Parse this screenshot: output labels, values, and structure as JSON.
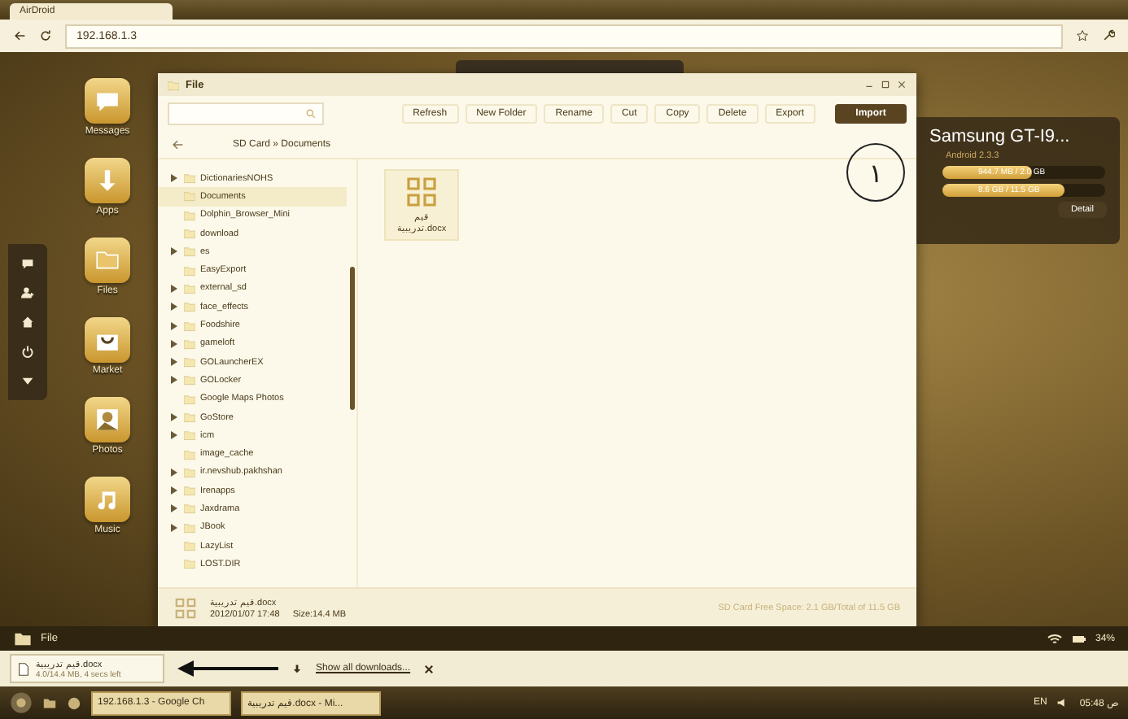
{
  "browser": {
    "tab": "AirDroid",
    "url": "192.168.1.3"
  },
  "dock_apps": [
    {
      "label": "Messages",
      "kind": "messages"
    },
    {
      "label": "Apps",
      "kind": "apps"
    },
    {
      "label": "Files",
      "kind": "files"
    },
    {
      "label": "Market",
      "kind": "market"
    },
    {
      "label": "Photos",
      "kind": "photos"
    },
    {
      "label": "Music",
      "kind": "music"
    }
  ],
  "side_tools": [
    {
      "kind": "chat"
    },
    {
      "kind": "user"
    },
    {
      "kind": "home"
    },
    {
      "kind": "power"
    },
    {
      "kind": "down"
    }
  ],
  "file_window": {
    "title": "File",
    "toolbar": [
      {
        "label": "Refresh",
        "kind": "plain"
      },
      {
        "label": "New Folder",
        "kind": "plain"
      },
      {
        "label": "Rename",
        "kind": "plain"
      },
      {
        "label": "Cut",
        "kind": "plain"
      },
      {
        "label": "Copy",
        "kind": "plain"
      },
      {
        "label": "Delete",
        "kind": "plain"
      },
      {
        "label": "Export",
        "kind": "plain"
      },
      {
        "label": "Import",
        "kind": "primary"
      }
    ],
    "path": "SD Card » Documents",
    "tree": [
      {
        "name": "DictionariesNOHS",
        "expandable": true,
        "selected": false
      },
      {
        "name": "Documents",
        "expandable": false,
        "selected": true
      },
      {
        "name": "Dolphin_Browser_Mini",
        "expandable": false,
        "selected": false
      },
      {
        "name": "download",
        "expandable": false,
        "selected": false
      },
      {
        "name": "es",
        "expandable": true,
        "selected": false
      },
      {
        "name": "EasyExport",
        "expandable": false,
        "selected": false
      },
      {
        "name": "external_sd",
        "expandable": true,
        "selected": false
      },
      {
        "name": "face_effects",
        "expandable": true,
        "selected": false
      },
      {
        "name": "Foodshire",
        "expandable": true,
        "selected": false
      },
      {
        "name": "gameloft",
        "expandable": true,
        "selected": false
      },
      {
        "name": "GOLauncherEX",
        "expandable": true,
        "selected": false
      },
      {
        "name": "GOLocker",
        "expandable": true,
        "selected": false
      },
      {
        "name": "Google Maps Photos",
        "expandable": false,
        "selected": false
      },
      {
        "name": "GoStore",
        "expandable": true,
        "selected": false
      },
      {
        "name": "icm",
        "expandable": true,
        "selected": false
      },
      {
        "name": "image_cache",
        "expandable": false,
        "selected": false
      },
      {
        "name": "ir.nevshub.pakhshan",
        "expandable": true,
        "selected": false
      },
      {
        "name": "Irenapps",
        "expandable": true,
        "selected": false
      },
      {
        "name": "Jaxdrama",
        "expandable": true,
        "selected": false
      },
      {
        "name": "JBook",
        "expandable": true,
        "selected": false
      },
      {
        "name": "LazyList",
        "expandable": false,
        "selected": false
      },
      {
        "name": "LOST.DIR",
        "expandable": false,
        "selected": false
      }
    ],
    "files": [
      {
        "name": "قيم تدريبية.docx"
      }
    ],
    "status": {
      "file": "قيم تدريبية.docx",
      "date": "2012/01/07 17:48",
      "size": "Size:14.4 MB",
      "free_space": "SD Card Free Space: 2.1 GB/Total of 11.5 GB"
    }
  },
  "annotation": {
    "number": "١"
  },
  "device": {
    "name": "Samsung GT-I9...",
    "os": "Android 2.3.3",
    "storage": [
      {
        "reading": "944.7 MB / 2.0 GB",
        "level": 0.55
      },
      {
        "reading": "8.6 GB / 11.5 GB",
        "level": 0.75
      }
    ],
    "detail": "Detail"
  },
  "dock": {
    "item": "File",
    "battery": "34%"
  },
  "download": {
    "file": "قيم تدريبية.docx",
    "progress": "4.0/14.4 MB, 4 secs left",
    "show_all": "Show all downloads..."
  },
  "taskbar": {
    "tasks": [
      "192.168.1.3 - Google Ch",
      "قيم تدريبية.docx - Mi..."
    ],
    "language": "EN",
    "time": "05:48 ص"
  }
}
